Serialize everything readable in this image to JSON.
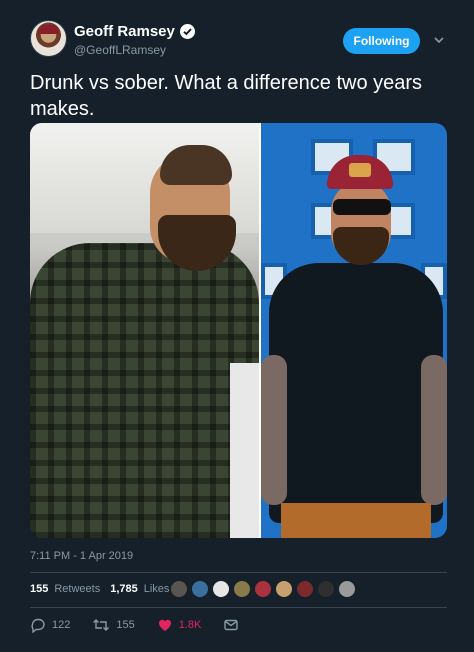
{
  "user": {
    "name": "Geoff Ramsey",
    "handle": "@GeoffLRamsey",
    "verified": true
  },
  "follow_button": {
    "label": "Following"
  },
  "tweet": {
    "text": "Drunk vs sober. What a difference two years makes."
  },
  "timestamp": "7:11 PM - 1 Apr 2019",
  "stats": {
    "retweets_count": "155",
    "retweets_label": "Retweets",
    "likes_count": "1,785",
    "likes_label": "Likes"
  },
  "actions": {
    "replies": "122",
    "retweets": "155",
    "likes": "1.8K"
  },
  "colors": {
    "background": "#15202b",
    "accent": "#1da1f2",
    "like": "#e0245e",
    "muted": "#8899a6"
  },
  "icons": [
    "verified-badge-icon",
    "chevron-down-icon",
    "reply-icon",
    "retweet-icon",
    "heart-icon",
    "message-icon"
  ]
}
